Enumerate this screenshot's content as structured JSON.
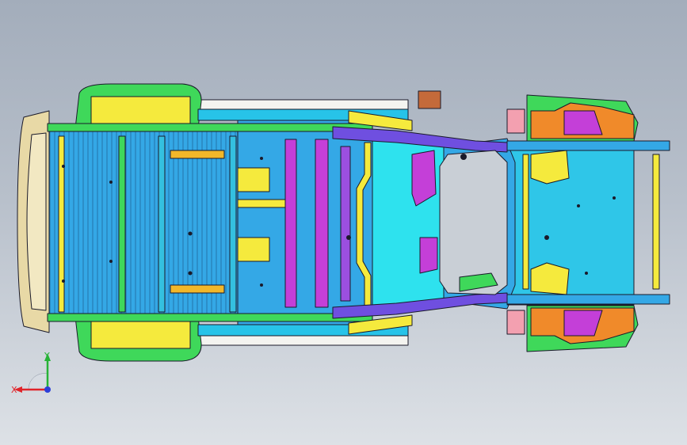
{
  "viewport": {
    "background_top": "#a3adbb",
    "background_bottom": "#dde1e6"
  },
  "triad": {
    "x_label": "X",
    "y_label": "Y",
    "x_color": "#e0242a",
    "y_color": "#27b336",
    "z_color": "#2c3fd8"
  },
  "palette": {
    "floor_blue": "#34a8e6",
    "cyan": "#26e0f0",
    "green": "#3fd85a",
    "yellow": "#f5ea3d",
    "magenta": "#c43fd8",
    "purple": "#6f4fe0",
    "orange": "#f08a2a",
    "tan": "#e8d9a6",
    "white": "#f4f4f0",
    "outline": "#1a1a2a"
  },
  "icons": {
    "model": "car-body-underbody-icon",
    "triad": "coordinate-triad-icon"
  }
}
